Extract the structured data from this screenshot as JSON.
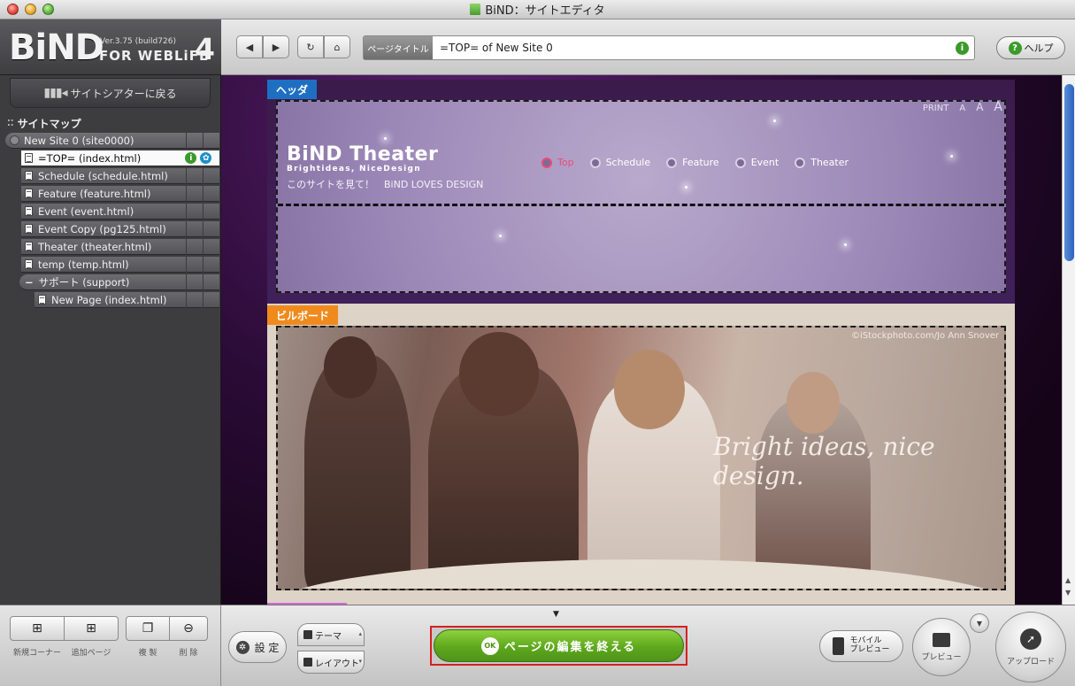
{
  "window": {
    "title": "BiND：サイトエディタ"
  },
  "logo": {
    "name": "BiND",
    "version": "Ver.3.75 (build726)",
    "product": "FOR WEBLiFE",
    "edition": "4"
  },
  "toolbar": {
    "back_icon": "◀",
    "forward_icon": "▶",
    "reload_icon": "↻",
    "home_icon": "⌂",
    "page_title_label": "ページタイトル",
    "page_title_value": "=TOP= of New Site 0",
    "info_icon": "i",
    "help_label": "ヘルプ"
  },
  "sidebar": {
    "back_label": "サイトシアターに戻る",
    "sitemap_title": "サイトマップ",
    "root": "New Site 0 (site0000)",
    "pages": [
      "=TOP= (index.html)",
      "Schedule (schedule.html)",
      "Feature (feature.html)",
      "Event (event.html)",
      "Event Copy (pg125.html)",
      "Theater (theater.html)",
      "temp (temp.html)"
    ],
    "folder": "サポート (support)",
    "folder_toggle": "−",
    "sub_page": "New Page (index.html)",
    "badge_info": "i",
    "badge_gear": "✿"
  },
  "sidebar_actions": {
    "new_corner": "新規コーナー",
    "add_page": "追加ページ",
    "duplicate": "複 製",
    "delete": "削 除"
  },
  "canvas": {
    "header_tag": "ヘッダ",
    "print_links": [
      "PRINT",
      "A",
      "A",
      "A"
    ],
    "site_name": "BiND Theater",
    "site_sub": "Brightideas, NiceDesign",
    "site_catch": "このサイトを見て！　BiND LOVES DESIGN",
    "nav": [
      "Top",
      "Schedule",
      "Feature",
      "Event",
      "Theater"
    ],
    "billboard_tag": "ビルボード",
    "billboard_credit": "©iStockphoto.com/Jo Ann Snover",
    "billboard_slogan": "Bright ideas, nice design."
  },
  "bottom": {
    "settings_label": "設 定",
    "theme_label": "テーマ",
    "layout_label": "レイアウト",
    "finish_ok": "OK",
    "finish_label": "ページの編集を終える",
    "mobile_label_1": "モバイル",
    "mobile_label_2": "プレビュー",
    "preview_label": "プレビュー",
    "upload_label": "アップロード"
  },
  "colors": {
    "header_tag": "#1e6fc2",
    "billboard_tag": "#f08a1c",
    "finish_button": "#5ea81d",
    "active_nav": "#e84d78",
    "highlight_frame": "#d62020"
  }
}
